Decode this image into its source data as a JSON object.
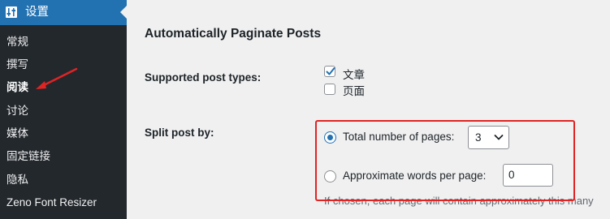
{
  "sidebar": {
    "header_label": "设置",
    "header_icon": "settings-sliders-icon",
    "items": [
      {
        "label": "常规"
      },
      {
        "label": "撰写"
      },
      {
        "label": "阅读",
        "active": true
      },
      {
        "label": "讨论"
      },
      {
        "label": "媒体"
      },
      {
        "label": "固定链接"
      },
      {
        "label": "隐私"
      },
      {
        "label": "Zeno Font Resizer"
      }
    ]
  },
  "main": {
    "title": "Automatically Paginate Posts",
    "post_types": {
      "label": "Supported post types:",
      "options": [
        {
          "label": "文章",
          "checked": true
        },
        {
          "label": "页面",
          "checked": false
        }
      ]
    },
    "split": {
      "label": "Split post by:",
      "total_pages_label": "Total number of pages:",
      "total_pages_value": "3",
      "words_label": "Approximate words per page:",
      "words_value": "0",
      "selected": "total_pages",
      "description": "If chosen, each page will contain approximately this many"
    }
  },
  "colors": {
    "sidebar_bg": "#23282d",
    "accent": "#2271b1",
    "annotation": "#e02424"
  }
}
